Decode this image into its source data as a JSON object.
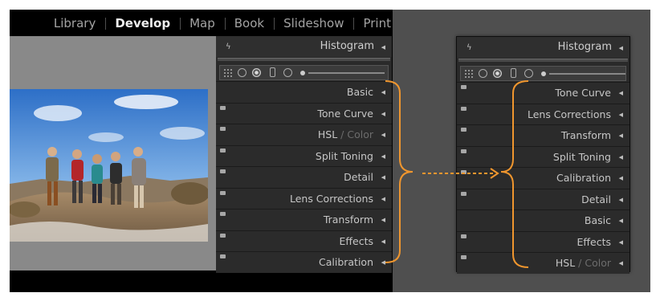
{
  "app": {
    "modules": [
      {
        "label": "Library",
        "active": false
      },
      {
        "label": "Develop",
        "active": true
      },
      {
        "label": "Map",
        "active": false
      },
      {
        "label": "Book",
        "active": false
      },
      {
        "label": "Slideshow",
        "active": false
      },
      {
        "label": "Print",
        "active": false
      }
    ]
  },
  "left_panel": {
    "histogram": {
      "title": "Histogram",
      "icon": "flash-icon"
    },
    "tools": [
      "crop-overlay-icon",
      "spot-removal-icon",
      "red-eye-icon",
      "graduated-filter-icon",
      "radial-filter-icon",
      "adjustment-brush-icon"
    ],
    "sections": [
      {
        "label": "Basic",
        "sub": "",
        "switch": false
      },
      {
        "label": "Tone Curve",
        "sub": "",
        "switch": true
      },
      {
        "label": "HSL",
        "sub": " / Color",
        "switch": true
      },
      {
        "label": "Split Toning",
        "sub": "",
        "switch": true
      },
      {
        "label": "Detail",
        "sub": "",
        "switch": true
      },
      {
        "label": "Lens Corrections",
        "sub": "",
        "switch": true
      },
      {
        "label": "Transform",
        "sub": "",
        "switch": true
      },
      {
        "label": "Effects",
        "sub": "",
        "switch": true
      },
      {
        "label": "Calibration",
        "sub": "",
        "switch": true
      }
    ]
  },
  "right_panel": {
    "histogram": {
      "title": "Histogram",
      "icon": "flash-icon"
    },
    "tools": [
      "crop-overlay-icon",
      "spot-removal-icon",
      "red-eye-icon",
      "graduated-filter-icon",
      "radial-filter-icon",
      "adjustment-brush-icon"
    ],
    "sections": [
      {
        "label": "Tone Curve",
        "sub": "",
        "switch": true
      },
      {
        "label": "Lens Corrections",
        "sub": "",
        "switch": true
      },
      {
        "label": "Transform",
        "sub": "",
        "switch": true
      },
      {
        "label": "Split Toning",
        "sub": "",
        "switch": true
      },
      {
        "label": "Calibration",
        "sub": "",
        "switch": true
      },
      {
        "label": "Detail",
        "sub": "",
        "switch": true
      },
      {
        "label": "Basic",
        "sub": "",
        "switch": false
      },
      {
        "label": "Effects",
        "sub": "",
        "switch": true
      },
      {
        "label": "HSL",
        "sub": " / Color",
        "switch": true
      }
    ]
  },
  "colors": {
    "accent_orange": "#f0962e",
    "panel_bg": "#2b2b2b",
    "backdrop": "#4f4f4f"
  }
}
